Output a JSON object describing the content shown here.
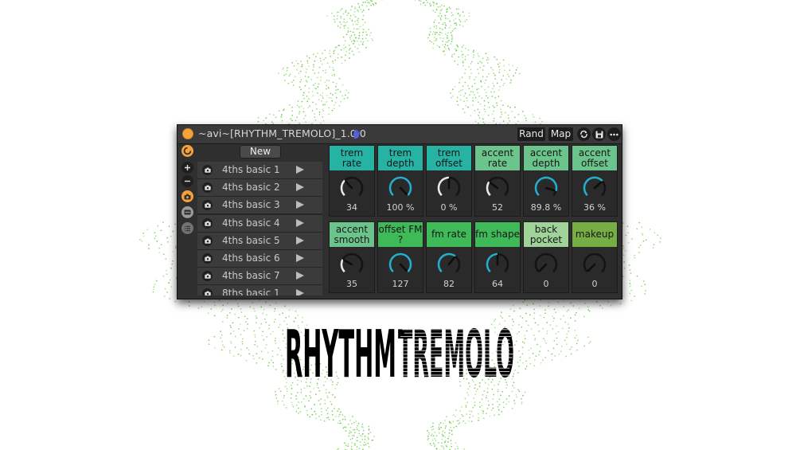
{
  "window": {
    "title": "~avi~[RHYTHM_TREMOLO]_1.0.0",
    "buttons": {
      "rand": "Rand",
      "map": "Map"
    },
    "title_icon": "hand-icon"
  },
  "sidebar_icons": [
    "power-logo-icon",
    "plus-icon",
    "minus-icon",
    "camera-icon",
    "save-icon",
    "list-icon"
  ],
  "presets": {
    "new_label": "New",
    "items": [
      {
        "name": "4ths basic 1"
      },
      {
        "name": "4ths basic 2"
      },
      {
        "name": "4ths basic 3"
      },
      {
        "name": "4ths basic 4"
      },
      {
        "name": "4ths basic 5"
      },
      {
        "name": "4ths basic 6"
      },
      {
        "name": "4ths basic 7"
      },
      {
        "name": "8ths basic 1"
      }
    ]
  },
  "params": [
    {
      "label": "trem rate",
      "value": "34",
      "color": "#27b3a3",
      "level": 0.34,
      "arc": "#e8e8e8"
    },
    {
      "label": "trem depth",
      "value": "100 %",
      "color": "#27b3a3",
      "level": 1.0,
      "arc": "#24aec9"
    },
    {
      "label": "trem offset",
      "value": "0 %",
      "color": "#27b3a3",
      "level": 0.5,
      "arc": "#e8e8e8"
    },
    {
      "label": "accent rate",
      "value": "52",
      "color": "#6cc48d",
      "level": 0.3,
      "arc": "#e8e8e8"
    },
    {
      "label": "accent depth",
      "value": "89.8 %",
      "color": "#6cc48d",
      "level": 0.898,
      "arc": "#24aec9"
    },
    {
      "label": "accent offset",
      "value": "36 %",
      "color": "#6cc48d",
      "level": 0.68,
      "arc": "#24aec9"
    },
    {
      "label": "accent smooth",
      "value": "35",
      "color": "#6cc48d",
      "level": 0.27,
      "arc": "#e8e8e8"
    },
    {
      "label": "offset FM ?",
      "value": "127",
      "color": "#3fba59",
      "level": 1.0,
      "arc": "#24aec9"
    },
    {
      "label": "fm rate",
      "value": "82",
      "color": "#3fba59",
      "level": 0.64,
      "arc": "#24aec9"
    },
    {
      "label": "fm shape",
      "value": "64",
      "color": "#3fba59",
      "level": 0.5,
      "arc": "#24aec9"
    },
    {
      "label": "back pocket",
      "value": "0",
      "color": "#9fd39a",
      "level": 0.0,
      "arc": "#e8e8e8"
    },
    {
      "label": "makeup",
      "value": "0",
      "color": "#77ae43",
      "level": 0.0,
      "arc": "#e8e8e8"
    }
  ],
  "logo": {
    "word1": "RHYTHM",
    "word2": "TREMOLO"
  },
  "colors": {
    "accent_orange": "#f5a23a",
    "knob_blue": "#24aec9",
    "wave_green": "#5fc83c"
  }
}
